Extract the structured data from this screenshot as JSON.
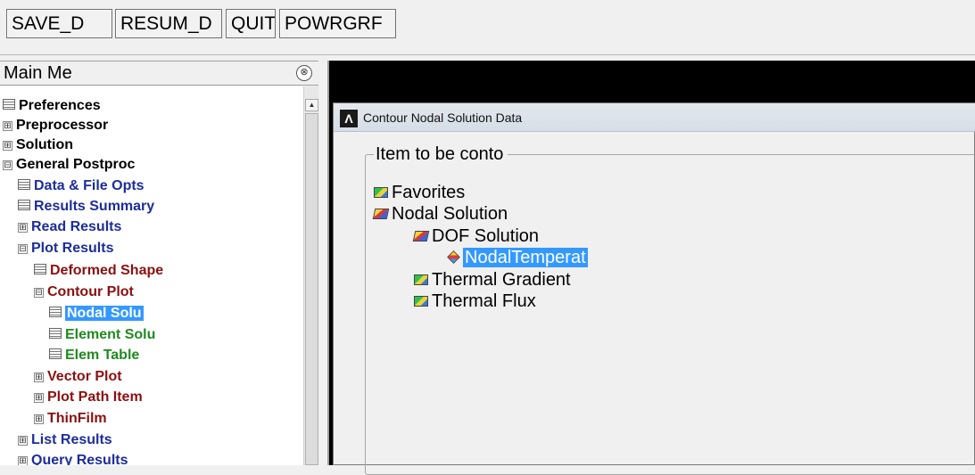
{
  "toolbar": {
    "buttons": [
      "SAVE_D",
      "RESUM_D",
      "QUIT",
      "POWRGRF"
    ]
  },
  "main_menu": {
    "title": "Main Me",
    "collapse_glyph": "⊗",
    "tree": [
      {
        "label": "Preferences",
        "expander": "",
        "icon": "doc-icon",
        "color": "#000000"
      },
      {
        "label": "Preprocessor",
        "expander": "⊞",
        "color": "#000000"
      },
      {
        "label": "Solution",
        "expander": "⊞",
        "color": "#000000"
      },
      {
        "label": "General Postproc",
        "expander": "⊟",
        "color": "#000000"
      },
      {
        "label": "Data & File Opts",
        "icon": "doc-icon",
        "color": "#1c2d9b"
      },
      {
        "label": "Results Summary",
        "icon": "doc-icon",
        "color": "#1c2d9b"
      },
      {
        "label": "Read Results",
        "expander": "⊞",
        "color": "#1c2d9b"
      },
      {
        "label": "Plot Results",
        "expander": "⊟",
        "color": "#1c2d9b"
      },
      {
        "label": "Deformed Shape",
        "icon": "doc-icon",
        "color": "#8b1010"
      },
      {
        "label": "Contour Plot",
        "expander": "⊟",
        "color": "#8b1010"
      },
      {
        "label": "Nodal Solu",
        "icon": "doc-icon",
        "color": "#ffffff",
        "selected": true
      },
      {
        "label": "Element Solu",
        "icon": "doc-icon",
        "color": "#1f8a1f"
      },
      {
        "label": "Elem Table",
        "icon": "doc-icon",
        "color": "#1f8a1f"
      },
      {
        "label": "Vector Plot",
        "expander": "⊞",
        "color": "#8b1010"
      },
      {
        "label": "Plot Path Item",
        "expander": "⊞",
        "color": "#8b1010"
      },
      {
        "label": "ThinFilm",
        "expander": "⊞",
        "color": "#8b1010"
      },
      {
        "label": "List Results",
        "expander": "⊞",
        "color": "#1c2d9b"
      },
      {
        "label": "Query Results",
        "expander": "⊞",
        "color": "#1c2d9b"
      }
    ],
    "scroll_up_glyph": "▲"
  },
  "dialog": {
    "logo": "Λ",
    "title": "Contour Nodal Solution Data",
    "group_label": "Item to be conto",
    "items": [
      {
        "label": "Favorites",
        "icon": "favorites-icon"
      },
      {
        "label": "Nodal Solution",
        "icon": "nodal-solution-icon"
      },
      {
        "label": "DOF Solution",
        "icon": "dof-solution-icon"
      },
      {
        "label": "NodalTemperat",
        "icon": "temperature-icon",
        "selected": true
      },
      {
        "label": "Thermal Gradient",
        "icon": "thermal-gradient-icon"
      },
      {
        "label": "Thermal Flux",
        "icon": "thermal-flux-icon"
      }
    ]
  }
}
